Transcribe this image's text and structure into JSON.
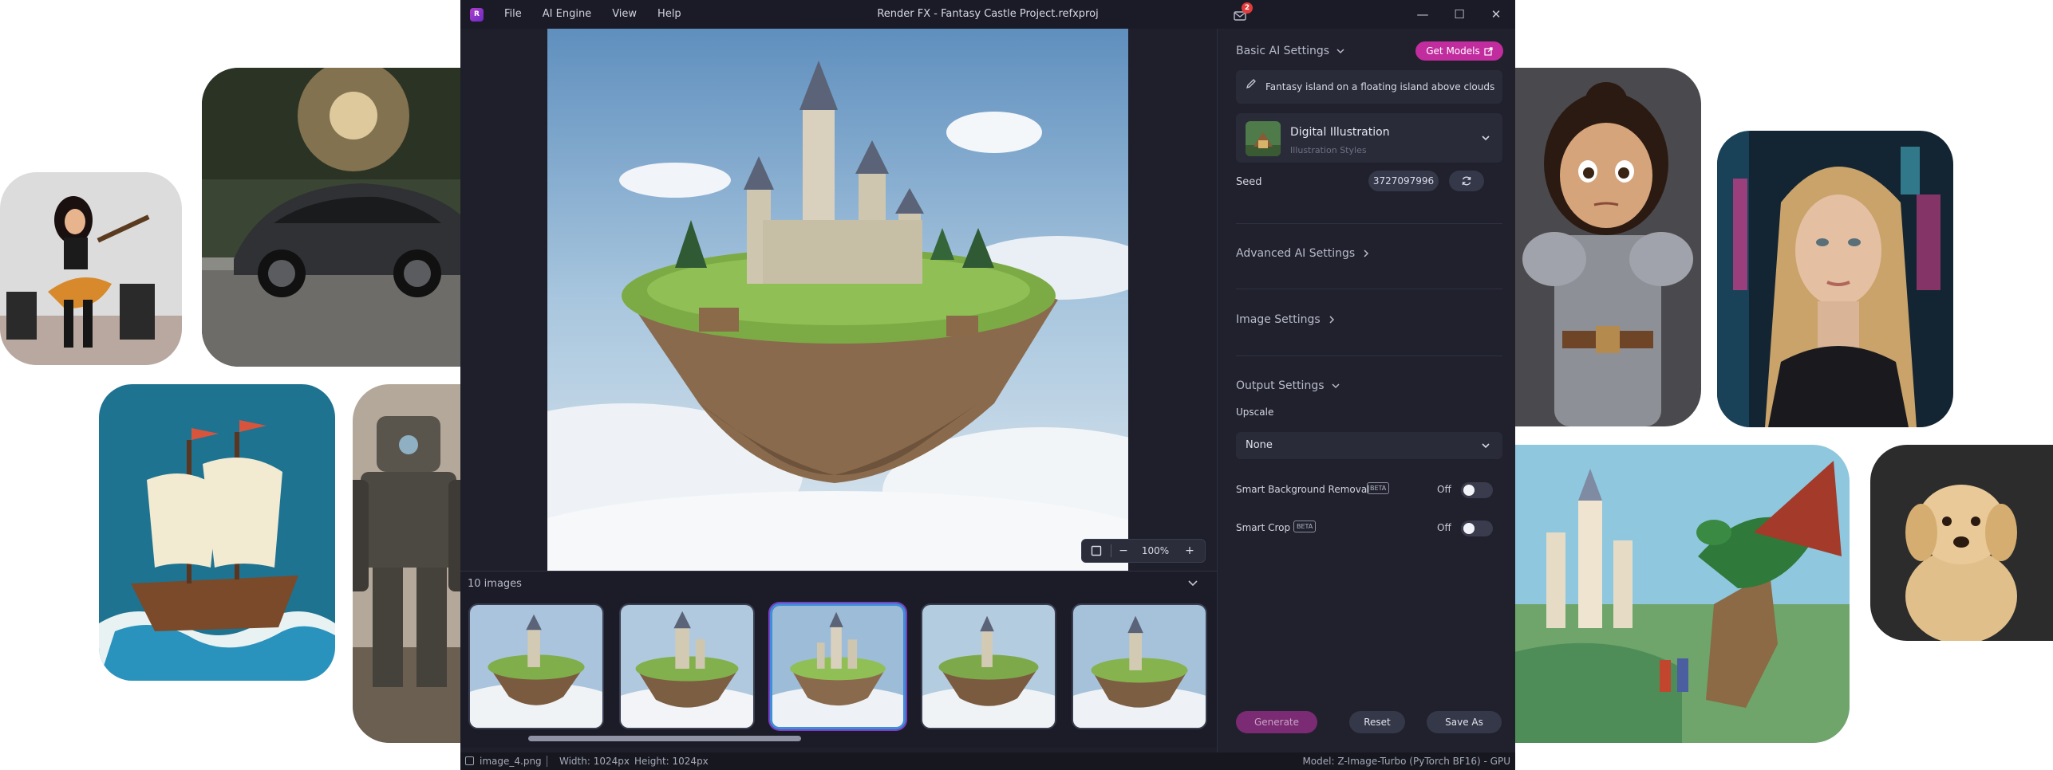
{
  "titlebar": {
    "title": "Render FX - Fantasy Castle Project.refxproj",
    "logo_text": "R",
    "menu": [
      "File",
      "AI Engine",
      "View",
      "Help"
    ],
    "notification_count": "2",
    "controls": [
      "—",
      "☐",
      "✕"
    ]
  },
  "canvas": {
    "zoom_value": "100%",
    "zoom_minus": "−",
    "zoom_plus": "+"
  },
  "gallery": {
    "count_label": "10 images",
    "selected_index": 2
  },
  "panel": {
    "basic_ai_settings": "Basic AI Settings",
    "get_models": "Get Models",
    "prompt": "Fantasy island on a floating island above clouds",
    "style_name": "Digital Illustration",
    "style_category": "Illustration Styles",
    "seed_label": "Seed",
    "seed_value": "3727097996",
    "advanced_ai_settings": "Advanced AI Settings",
    "image_settings": "Image Settings",
    "output_settings": "Output Settings",
    "upscale_label": "Upscale",
    "upscale_value": "None",
    "smart_bg_removal": "Smart Background Removal",
    "smart_crop": "Smart Crop",
    "beta": "BETA",
    "off": "Off",
    "generate": "Generate",
    "reset": "Reset",
    "save_as": "Save As"
  },
  "statusbar": {
    "file": "image_4.png",
    "width": "Width: 1024px",
    "height": "Height: 1024px",
    "model": "Model: Z-Image-Turbo (PyTorch BF16) - GPU"
  },
  "colors": {
    "accent": "#c12c9e",
    "selection": "#3e8ed8",
    "app_bg": "#1e1f2b"
  }
}
